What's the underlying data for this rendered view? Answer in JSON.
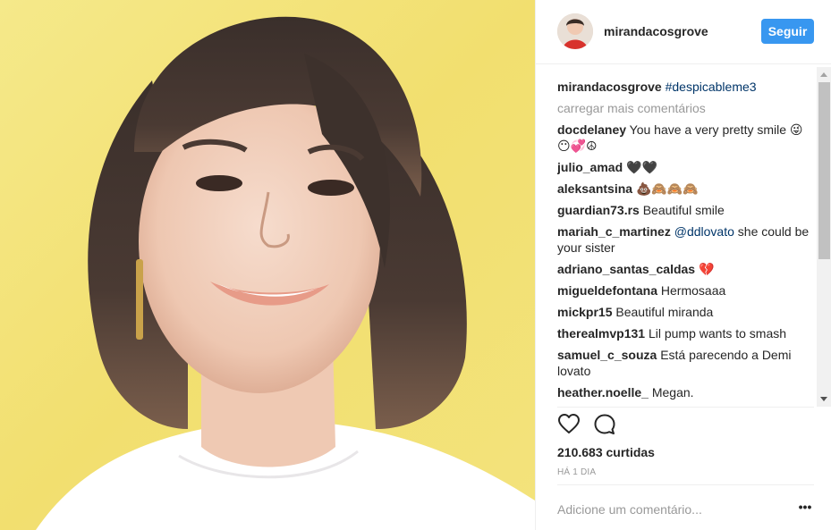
{
  "post": {
    "author": "mirandacosgrove",
    "follow_label": "Seguir",
    "caption_user": "mirandacosgrove",
    "caption_text": "#despicableme3",
    "load_more": "carregar mais comentários",
    "likes": "210.683 curtidas",
    "time_ago": "HÁ 1 DIA",
    "comment_placeholder": "Adicione um comentário...",
    "more_label": "•••"
  },
  "comments": [
    {
      "user": "docdelaney",
      "text": "You have a very pretty smile 😜😶💞☮"
    },
    {
      "user": "julio_amad",
      "text": "🖤🖤"
    },
    {
      "user": "aleksantsina",
      "text": "💩🙈🙈🙈"
    },
    {
      "user": "guardian73.rs",
      "text": "Beautiful smile"
    },
    {
      "user": "mariah_c_martinez",
      "tag": "@ddlovato",
      "text": " she could be your sister"
    },
    {
      "user": "adriano_santas_caldas",
      "text": "💔"
    },
    {
      "user": "migueldefontana",
      "text": "Hermosaaa"
    },
    {
      "user": "mickpr15",
      "text": "Beautiful miranda"
    },
    {
      "user": "therealmvp131",
      "text": "Lil pump wants to smash"
    },
    {
      "user": "samuel_c_souza",
      "text": "Está parecendo a Demi lovato"
    },
    {
      "user": "heather.noelle_",
      "text": " Megan."
    }
  ],
  "icons": {
    "like": "heart-icon",
    "comment": "comment-bubble-icon"
  }
}
